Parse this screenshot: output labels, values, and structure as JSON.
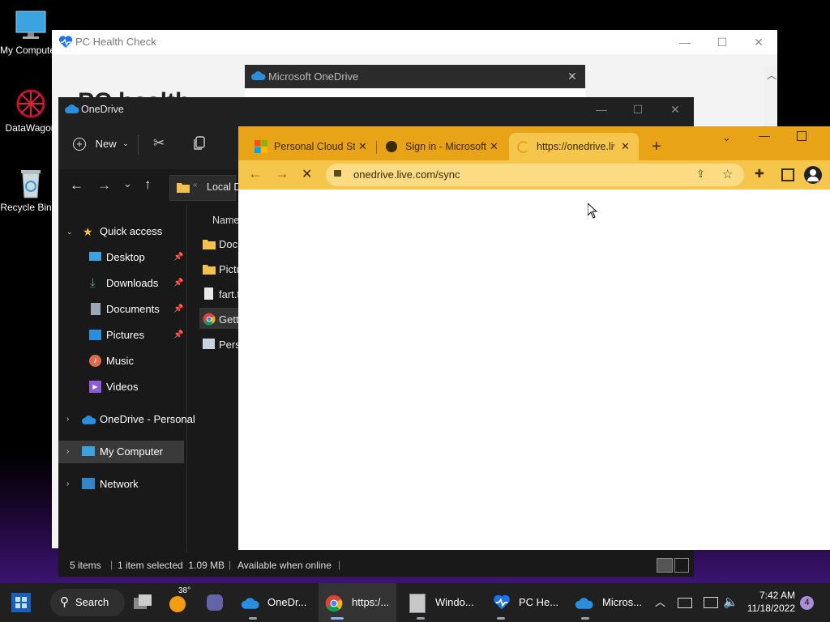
{
  "desktop": {
    "icons": [
      {
        "label": "My Computer",
        "icon": "monitor-icon"
      },
      {
        "label": "DataWagon",
        "icon": "datawagon-icon"
      },
      {
        "label": "Recycle Bin",
        "icon": "recycle-bin-icon"
      }
    ]
  },
  "pc_health": {
    "title": "PC Health Check",
    "heading_fragment": "PC health"
  },
  "onedrive_dialog": {
    "title": "Microsoft OneDrive"
  },
  "explorer": {
    "title": "OneDrive",
    "new_label": "New",
    "address": "Local D",
    "column_name": "Name",
    "files": [
      {
        "name": "Docu",
        "icon": "folder-icon"
      },
      {
        "name": "Pictu",
        "icon": "folder-icon"
      },
      {
        "name": "fart.t",
        "icon": "text-file-icon"
      },
      {
        "name": "Getti",
        "icon": "chrome-shortcut-icon"
      },
      {
        "name": "Perso",
        "icon": "shortcut-icon"
      }
    ],
    "nav": {
      "quick_access": "Quick access",
      "desktop": "Desktop",
      "downloads": "Downloads",
      "documents": "Documents",
      "pictures": "Pictures",
      "music": "Music",
      "videos": "Videos",
      "onedrive": "OneDrive - Personal",
      "my_computer": "My Computer",
      "network": "Network"
    },
    "status": {
      "items": "5 items",
      "selected": "1 item selected  1.09 MB",
      "availability": "Available when online"
    }
  },
  "chrome": {
    "tabs": [
      {
        "title": "Personal Cloud Sto",
        "icon": "microsoft-logo-icon"
      },
      {
        "title": "Sign in - Microsoft",
        "icon": "globe-icon"
      },
      {
        "title": "https://onedrive.liv",
        "icon": "loading-spinner-icon"
      }
    ],
    "url": "onedrive.live.com/sync",
    "accent": "#e8a317"
  },
  "taskbar": {
    "search": "Search",
    "weather_temp": "38°",
    "apps": [
      {
        "label": "OneDr...",
        "icon": "onedrive-icon"
      },
      {
        "label": "https:/...",
        "icon": "chrome-icon"
      },
      {
        "label": "Windo...",
        "icon": "installer-icon"
      },
      {
        "label": "PC He...",
        "icon": "pc-health-icon"
      },
      {
        "label": "Micros...",
        "icon": "onedrive-icon"
      }
    ],
    "time": "7:42 AM",
    "date": "11/18/2022",
    "notification_count": "4"
  }
}
